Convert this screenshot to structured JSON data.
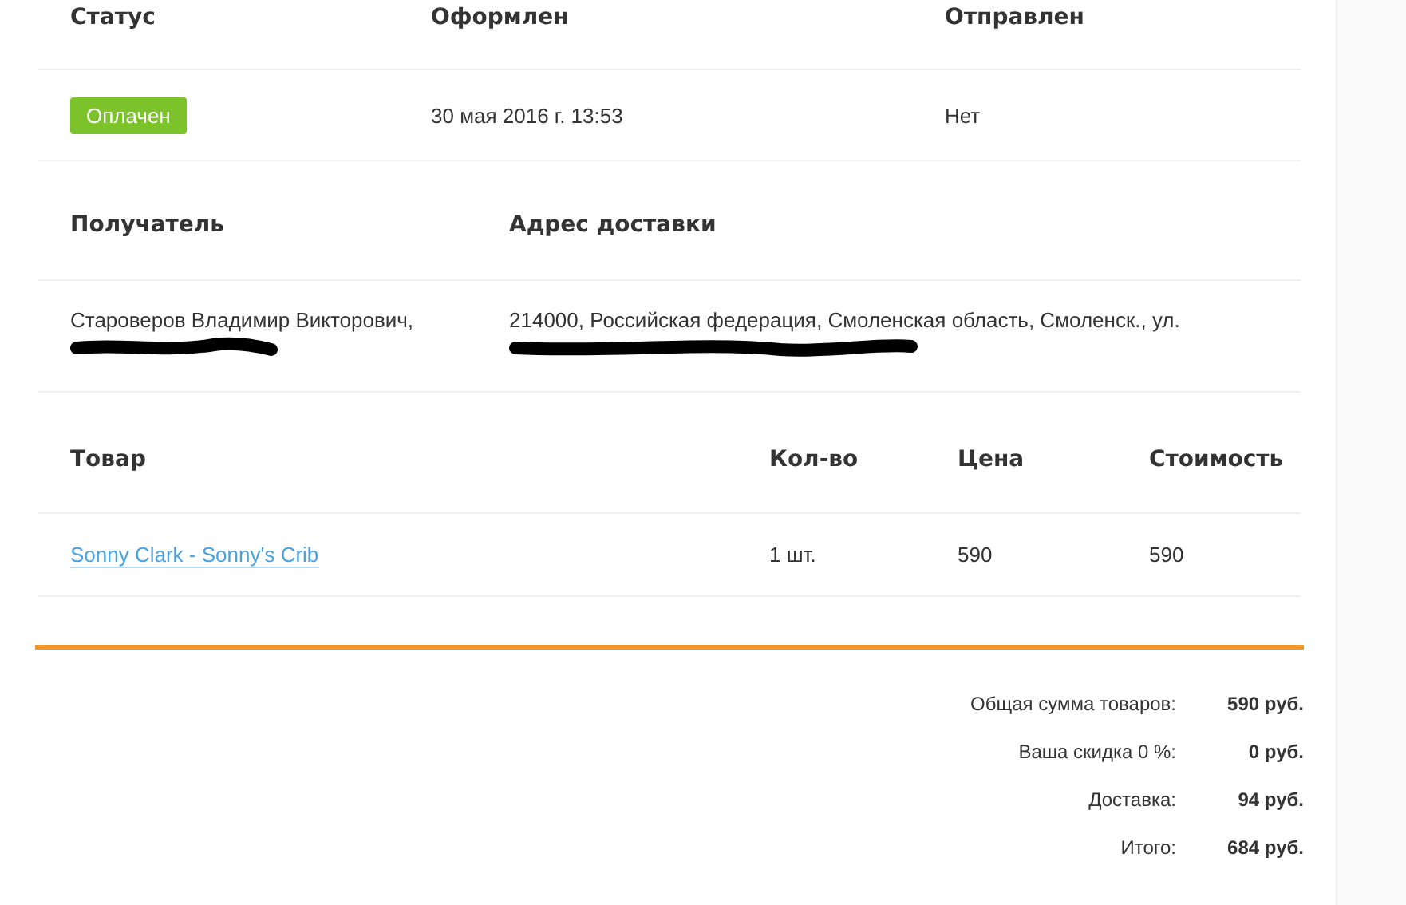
{
  "order": {
    "columns": [
      "Статус",
      "Оформлен",
      "Отправлен"
    ],
    "status": "Оплачен",
    "created": "30 мая 2016 г. 13:53",
    "shipped": "Нет"
  },
  "delivery": {
    "columns": [
      "Получатель",
      "Адрес доставки"
    ],
    "recipient": "Староверов Владимир Викторович,",
    "address": "214000, Российская федерация, Смоленская область, Смоленск., ул."
  },
  "items": {
    "columns": [
      "Товар",
      "Кол-во",
      "Цена",
      "Стоимость"
    ],
    "rows": [
      {
        "product": "Sonny Clark - Sonny's Crib",
        "quantity": "1 шт.",
        "price": "590",
        "cost": "590"
      }
    ]
  },
  "totals": [
    {
      "label": "Общая сумма товаров:",
      "value": "590 руб."
    },
    {
      "label": "Ваша скидка 0 %:",
      "value": "0 руб."
    },
    {
      "label": "Доставка:",
      "value": "94 руб."
    },
    {
      "label": "Итого:",
      "value": "684 руб."
    }
  ]
}
